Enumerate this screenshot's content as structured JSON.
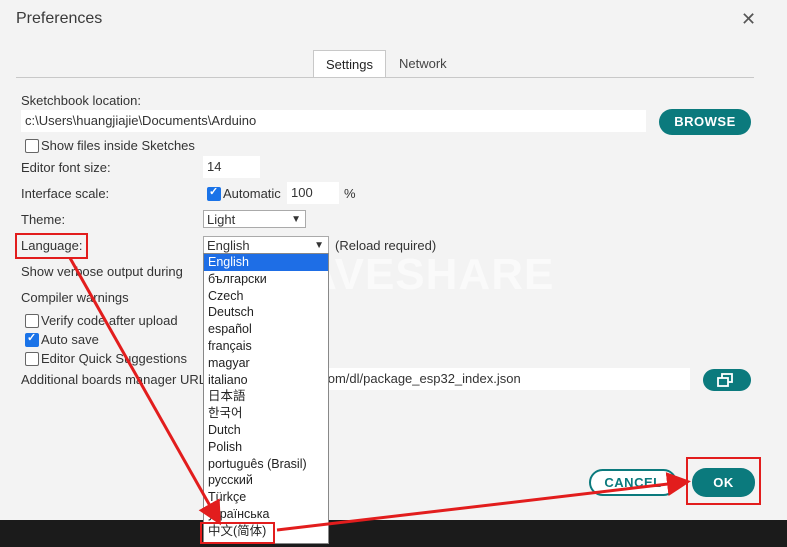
{
  "dialog": {
    "title": "Preferences",
    "close_label": "✕"
  },
  "tabs": [
    {
      "label": "Settings"
    },
    {
      "label": "Network"
    }
  ],
  "sketchbook": {
    "label": "Sketchbook location:",
    "value": "c:\\Users\\huangjiajie\\Documents\\Arduino",
    "browse_label": "BROWSE"
  },
  "show_files": {
    "label": "Show files inside Sketches",
    "checked": false
  },
  "font_size": {
    "label": "Editor font size:",
    "value": "14"
  },
  "interface_scale": {
    "label": "Interface scale:",
    "auto_label": "Automatic",
    "auto_checked": true,
    "value": "100",
    "unit": "%"
  },
  "theme": {
    "label": "Theme:",
    "value": "Light"
  },
  "language": {
    "label": "Language:",
    "value": "English",
    "note": "(Reload required)"
  },
  "verbose": {
    "label": "Show verbose output during"
  },
  "compiler_warnings": {
    "label": "Compiler warnings"
  },
  "verify_code": {
    "label": "Verify code after upload",
    "checked": false
  },
  "auto_save": {
    "label": "Auto save",
    "checked": true
  },
  "quick_suggestions": {
    "label": "Editor Quick Suggestions",
    "checked": false
  },
  "boards_url": {
    "label": "Additional boards manager URL",
    "value": "f.com/dl/package_esp32_index.json"
  },
  "language_options": [
    "English",
    "български",
    "Czech",
    "Deutsch",
    "español",
    "français",
    "magyar",
    "italiano",
    "日本語",
    "한국어",
    "Dutch",
    "Polish",
    "português (Brasil)",
    "русский",
    "Türkçe",
    "українська",
    "中文(简体)"
  ],
  "selected_language_index": 0,
  "watermark": "WAVESHARE",
  "buttons": {
    "cancel": "CANCEL",
    "ok": "OK"
  },
  "colors": {
    "accent": "#0b7a7d",
    "highlight_red": "#e21d1d",
    "selection_blue": "#1e6ee6"
  }
}
